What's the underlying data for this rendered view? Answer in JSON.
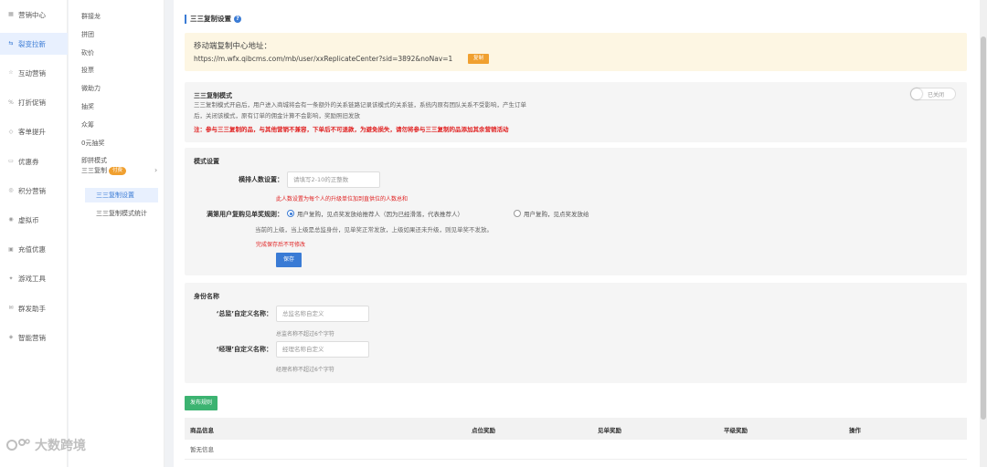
{
  "nav_primary": [
    {
      "label": "营销中心",
      "icon": "grid-icon"
    },
    {
      "label": "裂变拉新",
      "icon": "share-icon",
      "active": true
    },
    {
      "label": "互动营销",
      "icon": "star-icon"
    },
    {
      "label": "打折促销",
      "icon": "tag-icon"
    },
    {
      "label": "客单提升",
      "icon": "cart-icon"
    },
    {
      "label": "优惠券",
      "icon": "coupon-icon"
    },
    {
      "label": "积分营销",
      "icon": "points-icon"
    },
    {
      "label": "虚拟币",
      "icon": "coin-icon"
    },
    {
      "label": "充值优惠",
      "icon": "wallet-icon"
    },
    {
      "label": "游戏工具",
      "icon": "game-icon"
    },
    {
      "label": "群发助手",
      "icon": "message-icon"
    },
    {
      "label": "智能营销",
      "icon": "robot-icon"
    }
  ],
  "nav_secondary": [
    "群接龙",
    "拼团",
    "砍价",
    "投票",
    "微助力",
    "抽奖",
    "众筹",
    "0元抽奖",
    "即拼模式"
  ],
  "nav_group": {
    "label": "三三复制",
    "badge": "付费"
  },
  "nav_sub": [
    "三三复制设置",
    "三三复制模式统计"
  ],
  "section_title": "三三复制设置",
  "notice": {
    "title": "移动端复制中心地址：",
    "url": "https://m.wfx.qibcms.com/mb/user/xxReplicateCenter?sid=3892&noNav=1",
    "copy_label": "复制"
  },
  "mode": {
    "title": "三三复制模式",
    "desc1": "三三复制模式开启后，用户进入商城将会有一条额外的关系链路记录该模式的关系链，系统内原有团队关系不受影响，产生订单",
    "desc2": "后，关闭该模式，原有订单的佣金计算不会影响，奖励照旧发放",
    "warning": "注：参与三三复制的品，与其他营销不兼容，下单后不可退款，为避免损失，请勿将参与三三复制的品添加其余营销活动",
    "toggle_label": "已关闭"
  },
  "settings": {
    "title": "模式设置",
    "count_label": "横排人数设置：",
    "count_placeholder": "请填写2-10的正整数",
    "count_hint": "此人数设置为每个人的升级单位加到直供位的人数总和",
    "rule_label": "满第用户复购见单奖规则：",
    "option1": "用户复购，见点奖发放给推荐人（因为已经滑落，代表推荐人）",
    "option2": "用户复购，见点奖发放给",
    "rule_desc": "当前的上级，当上级是总监身份，见单奖正常发放，上级如果还未升级，则见单奖不发放。",
    "rule_hint": "完成保存后不可修改",
    "save_label": "保存"
  },
  "identity": {
    "title": "身份名称",
    "director_label": "‘总监’自定义名称：",
    "director_placeholder": "总监名称自定义",
    "director_hint": "总监名称不超过6个字符",
    "manager_label": "‘经理’自定义名称：",
    "manager_placeholder": "经理名称自定义",
    "manager_hint": "经理名称不超过6个字符"
  },
  "publish_label": "发布规则",
  "table": {
    "headers": [
      "商品信息",
      "点位奖励",
      "见单奖励",
      "平级奖励",
      "操作"
    ],
    "empty": "暂无信息"
  },
  "watermark": "大数跨境"
}
